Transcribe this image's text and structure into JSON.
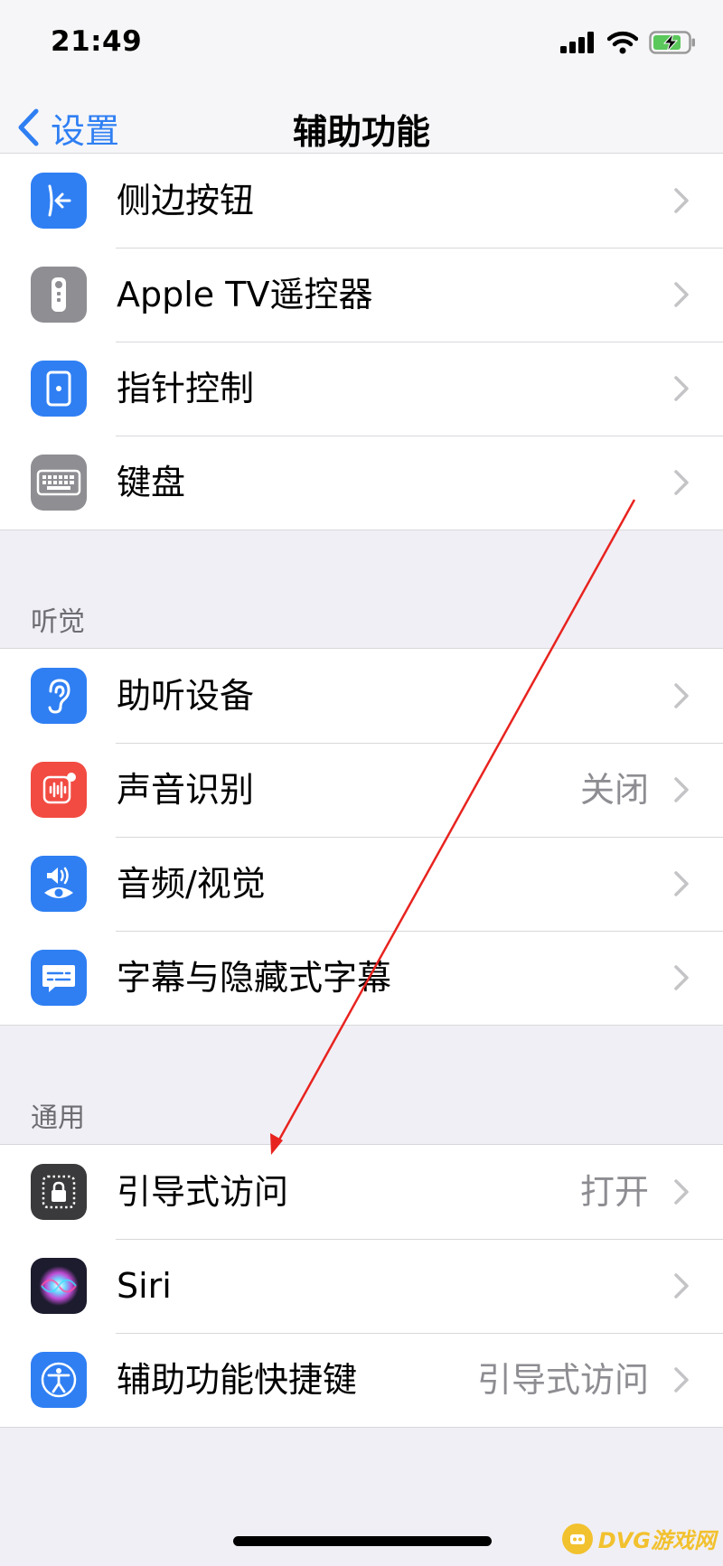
{
  "status": {
    "time": "21:49"
  },
  "nav": {
    "back_label": "设置",
    "title": "辅助功能"
  },
  "colors": {
    "accent": "#2f7ff3",
    "icon_blue": "#2f7ff3",
    "icon_gray": "#8e8e93",
    "icon_red": "#f24b42",
    "icon_dark": "#3a3a3c",
    "annotation_red": "#e8231f"
  },
  "groups": [
    {
      "header": "",
      "items": [
        {
          "label": "侧边按钮",
          "value": "",
          "icon": "side-button-icon"
        },
        {
          "label": "Apple TV遥控器",
          "value": "",
          "icon": "apple-tv-remote-icon"
        },
        {
          "label": "指针控制",
          "value": "",
          "icon": "pointer-control-icon"
        },
        {
          "label": "键盘",
          "value": "",
          "icon": "keyboard-icon"
        }
      ]
    },
    {
      "header": "听觉",
      "items": [
        {
          "label": "助听设备",
          "value": "",
          "icon": "hearing-device-icon"
        },
        {
          "label": "声音识别",
          "value": "关闭",
          "icon": "sound-recognition-icon"
        },
        {
          "label": "音频/视觉",
          "value": "",
          "icon": "audio-visual-icon"
        },
        {
          "label": "字幕与隐藏式字幕",
          "value": "",
          "icon": "subtitles-icon"
        }
      ]
    },
    {
      "header": "通用",
      "items": [
        {
          "label": "引导式访问",
          "value": "打开",
          "icon": "guided-access-icon"
        },
        {
          "label": "Siri",
          "value": "",
          "icon": "siri-icon"
        },
        {
          "label": "辅助功能快捷键",
          "value": "引导式访问",
          "icon": "accessibility-shortcut-icon"
        }
      ]
    }
  ],
  "watermark": {
    "text": "DVG游戏网"
  }
}
